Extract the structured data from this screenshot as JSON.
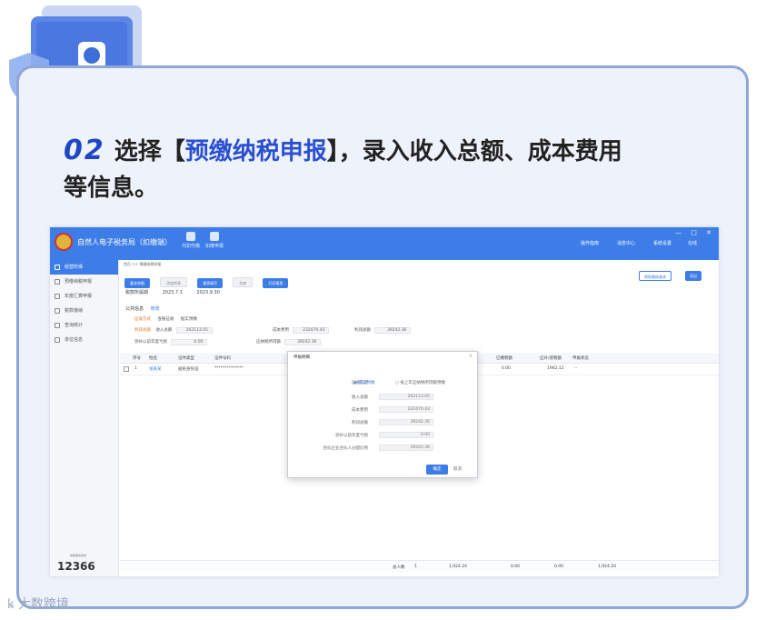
{
  "heading": {
    "step_number": "02",
    "prefix": "选择【",
    "highlight": "预缴纳税申报",
    "suffix": "】，录入收入总额、成本费用",
    "line2": "等信息。"
  },
  "app": {
    "title": "自然人电子税务局（扣缴端）",
    "toolbar": [
      {
        "label": "代扣代缴"
      },
      {
        "label": "扣缴申报"
      }
    ],
    "header_right": [
      "操作指南",
      "消息中心",
      "系统设置",
      "在线"
    ],
    "window_controls": "— □ ✕"
  },
  "sidebar": {
    "items": [
      {
        "label": "经营所得",
        "active": true
      },
      {
        "label": "预缴纳税申报",
        "active": false
      },
      {
        "label": "年度汇算申报",
        "active": false
      },
      {
        "label": "税款缴纳",
        "active": false
      },
      {
        "label": "查询统计",
        "active": false
      },
      {
        "label": "单位信息",
        "active": false
      }
    ],
    "hotline_label": "纳税服务热线",
    "hotline": "12366"
  },
  "content": {
    "breadcrumb": "首页 >> 预缴纳税申报",
    "buttons": [
      "基本申报",
      "添加附表",
      "报表填写",
      "作废",
      "打印报表"
    ],
    "right_buttons": [
      "税款缴纳查询",
      "导出"
    ],
    "period_label": "税款所属期",
    "period_start": "2023.7.1",
    "period_end": "2023.9.30",
    "section_title": "公共信息",
    "section_edit": "修改",
    "form": {
      "method_label": "征收方式",
      "method_value": "查账征收",
      "method_extra": "据实预缴",
      "income_label": "收入总额",
      "income_value": "262113.05",
      "cost_label": "成本费用",
      "cost_value": "232470.43",
      "profit_label": "利润总额",
      "profit_value": "39242.36",
      "deduction_label": "弥补以前年度亏损",
      "deduction_value": "0.00",
      "share_label": "应纳税所得额",
      "share_value": "39242.36",
      "calc_label": "利润总额"
    },
    "table": {
      "headers": [
        "序号",
        "姓名",
        "证件类型",
        "证件号码",
        "",
        "已缴税额",
        "应补/退税额",
        "申报状态"
      ],
      "rows": [
        {
          "no": "1",
          "name": "张某某",
          "id_type": "居民身份证",
          "id_no": "**************",
          "paid": "0.00",
          "due": "1962.12",
          "status": "--"
        }
      ],
      "footer": {
        "count_label": "总人数",
        "count": "1",
        "v1": "1,924.24",
        "v2": "0.00",
        "v3": "0.00",
        "v4": "1,924.24"
      }
    }
  },
  "dialog": {
    "title": "申报明细",
    "close": "×",
    "lines": [
      {
        "label": "征收方式",
        "value": "据实预缴",
        "radio": true,
        "extra": "按上年应纳税所得额预缴"
      },
      {
        "label": "收入总额",
        "value": "262113.05"
      },
      {
        "label": "成本费用",
        "value": "232470.43"
      },
      {
        "label": "利润总额",
        "value": "39242.36"
      },
      {
        "label": "弥补以前年度亏损",
        "value": "0.00"
      },
      {
        "label": "合伙企业合伙人分配比例",
        "value": "39242.36"
      }
    ],
    "ok": "确定",
    "cancel": "取消"
  },
  "watermark": "大数跨境"
}
